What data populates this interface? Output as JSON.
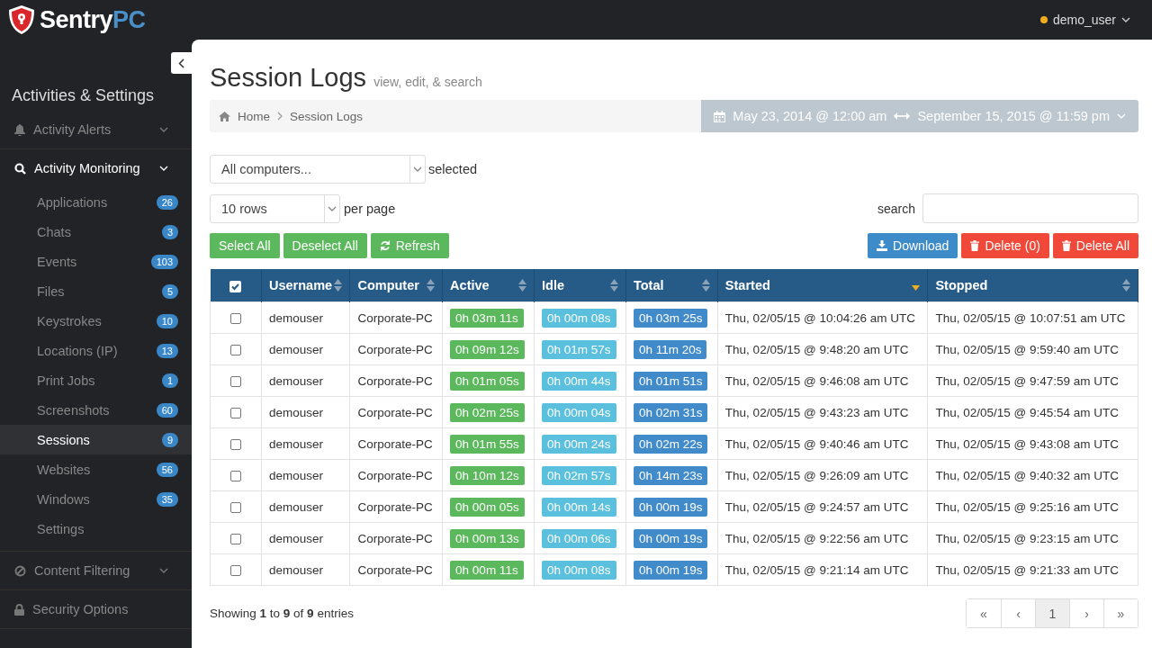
{
  "logo": {
    "text": "Sentry",
    "accent": "PC"
  },
  "user": {
    "name": "demo_user"
  },
  "sidebar": {
    "title": "Activities & Settings",
    "groups": [
      {
        "label": "Activity Alerts",
        "expanded": false,
        "has_caret": true
      },
      {
        "label": "Activity Monitoring",
        "expanded": true,
        "has_caret": true,
        "children": [
          {
            "label": "Applications",
            "count": "26",
            "selected": false
          },
          {
            "label": "Chats",
            "count": "3",
            "selected": false
          },
          {
            "label": "Events",
            "count": "103",
            "selected": false
          },
          {
            "label": "Files",
            "count": "5",
            "selected": false
          },
          {
            "label": "Keystrokes",
            "count": "10",
            "selected": false
          },
          {
            "label": "Locations (IP)",
            "count": "13",
            "selected": false
          },
          {
            "label": "Print Jobs",
            "count": "1",
            "selected": false
          },
          {
            "label": "Screenshots",
            "count": "60",
            "selected": false
          },
          {
            "label": "Sessions",
            "count": "9",
            "selected": true
          },
          {
            "label": "Websites",
            "count": "56",
            "selected": false
          },
          {
            "label": "Windows",
            "count": "35",
            "selected": false
          },
          {
            "label": "Settings",
            "selected": false
          }
        ]
      },
      {
        "label": "Content Filtering",
        "expanded": false,
        "has_caret": true
      },
      {
        "label": "Security Options",
        "expanded": false,
        "has_caret": false
      }
    ]
  },
  "page": {
    "title": "Session Logs",
    "subtitle": "view, edit, & search"
  },
  "breadcrumb": [
    "Home",
    "Session Logs"
  ],
  "date_range": {
    "from": "May 23, 2014 @ 12:00 am",
    "to": "September 15, 2015 @ 11:59 pm"
  },
  "computer_select": {
    "value": "All computers...",
    "suffix": "selected"
  },
  "rows_select": {
    "value": "10 rows",
    "suffix": "per page"
  },
  "search": {
    "label": "search"
  },
  "left_buttons": [
    {
      "label": "Select All",
      "kind": "plain"
    },
    {
      "label": "Deselect All",
      "kind": "plain"
    },
    {
      "label": "Refresh",
      "kind": "refresh"
    }
  ],
  "right_buttons": [
    {
      "label": "Download",
      "kind": "download"
    },
    {
      "label": "Delete (0)",
      "kind": "delete"
    },
    {
      "label": "Delete All",
      "kind": "delete"
    }
  ],
  "table": {
    "columns": [
      {
        "kind": "checkbox",
        "checked": true
      },
      {
        "kind": "text",
        "label": "Username",
        "sorted": false
      },
      {
        "kind": "text",
        "label": "Computer",
        "sorted": false
      },
      {
        "kind": "text",
        "label": "Active",
        "sorted": false
      },
      {
        "kind": "text",
        "label": "Idle",
        "sorted": false
      },
      {
        "kind": "text",
        "label": "Total",
        "sorted": false
      },
      {
        "kind": "text",
        "label": "Started",
        "sorted": true
      },
      {
        "kind": "text",
        "label": "Stopped",
        "sorted": false
      }
    ],
    "rows": [
      {
        "checked": false,
        "username": "demouser",
        "computer": "Corporate-PC",
        "active": "0h 03m 11s",
        "idle": "0h 00m 08s",
        "total": "0h 03m 25s",
        "started": "Thu, 02/05/15 @ 10:04:26 am UTC",
        "stopped": "Thu, 02/05/15 @ 10:07:51 am UTC"
      },
      {
        "checked": false,
        "username": "demouser",
        "computer": "Corporate-PC",
        "active": "0h 09m 12s",
        "idle": "0h 01m 57s",
        "total": "0h 11m 20s",
        "started": "Thu, 02/05/15 @ 9:48:20 am UTC",
        "stopped": "Thu, 02/05/15 @ 9:59:40 am UTC"
      },
      {
        "checked": false,
        "username": "demouser",
        "computer": "Corporate-PC",
        "active": "0h 01m 05s",
        "idle": "0h 00m 44s",
        "total": "0h 01m 51s",
        "started": "Thu, 02/05/15 @ 9:46:08 am UTC",
        "stopped": "Thu, 02/05/15 @ 9:47:59 am UTC"
      },
      {
        "checked": false,
        "username": "demouser",
        "computer": "Corporate-PC",
        "active": "0h 02m 25s",
        "idle": "0h 00m 04s",
        "total": "0h 02m 31s",
        "started": "Thu, 02/05/15 @ 9:43:23 am UTC",
        "stopped": "Thu, 02/05/15 @ 9:45:54 am UTC"
      },
      {
        "checked": false,
        "username": "demouser",
        "computer": "Corporate-PC",
        "active": "0h 01m 55s",
        "idle": "0h 00m 24s",
        "total": "0h 02m 22s",
        "started": "Thu, 02/05/15 @ 9:40:46 am UTC",
        "stopped": "Thu, 02/05/15 @ 9:43:08 am UTC"
      },
      {
        "checked": false,
        "username": "demouser",
        "computer": "Corporate-PC",
        "active": "0h 10m 12s",
        "idle": "0h 02m 57s",
        "total": "0h 14m 23s",
        "started": "Thu, 02/05/15 @ 9:26:09 am UTC",
        "stopped": "Thu, 02/05/15 @ 9:40:32 am UTC"
      },
      {
        "checked": false,
        "username": "demouser",
        "computer": "Corporate-PC",
        "active": "0h 00m 05s",
        "idle": "0h 00m 14s",
        "total": "0h 00m 19s",
        "started": "Thu, 02/05/15 @ 9:24:57 am UTC",
        "stopped": "Thu, 02/05/15 @ 9:25:16 am UTC"
      },
      {
        "checked": false,
        "username": "demouser",
        "computer": "Corporate-PC",
        "active": "0h 00m 13s",
        "idle": "0h 00m 06s",
        "total": "0h 00m 19s",
        "started": "Thu, 02/05/15 @ 9:22:56 am UTC",
        "stopped": "Thu, 02/05/15 @ 9:23:15 am UTC"
      },
      {
        "checked": false,
        "username": "demouser",
        "computer": "Corporate-PC",
        "active": "0h 00m 11s",
        "idle": "0h 00m 08s",
        "total": "0h 00m 19s",
        "started": "Thu, 02/05/15 @ 9:21:14 am UTC",
        "stopped": "Thu, 02/05/15 @ 9:21:33 am UTC"
      }
    ]
  },
  "summary": "Showing **1** to **9** of **9** entries",
  "pagination": [
    {
      "label": "«",
      "selected": false
    },
    {
      "label": "‹",
      "selected": false
    },
    {
      "label": "1",
      "selected": true
    },
    {
      "label": "›",
      "selected": false
    },
    {
      "label": "»",
      "selected": false
    }
  ]
}
